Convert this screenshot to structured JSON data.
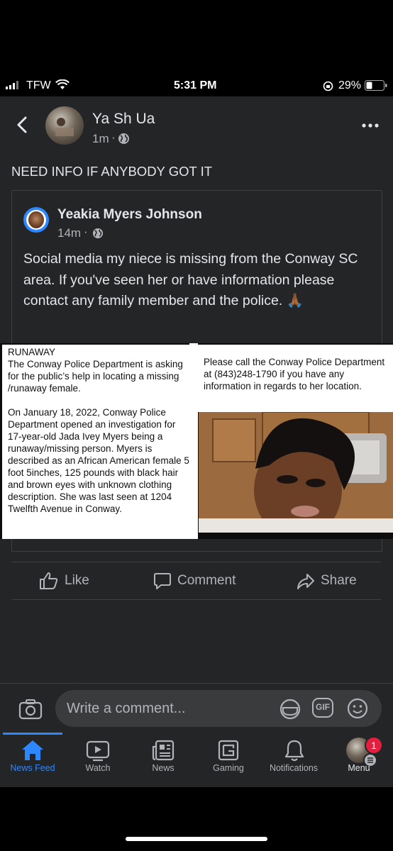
{
  "status_bar": {
    "carrier": "TFW",
    "time": "5:31 PM",
    "battery": "29%"
  },
  "header": {
    "author": "Ya Sh Ua",
    "time": "1m",
    "privacy_icon": "globe-icon"
  },
  "post_text": "NEED INFO IF ANYBODY GOT IT",
  "shared_post": {
    "author": "Yeakia Myers Johnson",
    "time": "14m",
    "text": "Social media my niece is missing from the Conway SC area. If you've seen her or have information please contact any family member and the police. 🙏🏾",
    "emoji": "🙏🏾",
    "image_left": {
      "heading": "RUNAWAY",
      "para1": "The Conway Police Department is asking for the public’s help in locating a missing /runaway female.",
      "para2": "On January 18, 2022, Conway Police Department opened an investigation for 17-year-old Jada Ivey Myers being a runaway/missing person. Myers is described as an African American female 5 foot 5inches, 125 pounds with black hair and brown eyes with unknown clothing description. She was last seen at 1204 Twelfth Avenue in Conway."
    },
    "image_right": {
      "text": "Please call the Conway Police Department at (843)248-1790 if you have any information in regards to her location."
    }
  },
  "actions": {
    "like": "Like",
    "comment": "Comment",
    "share": "Share"
  },
  "composer": {
    "placeholder": "Write a comment...",
    "gif": "GIF"
  },
  "bottom_nav": {
    "news_feed": "News Feed",
    "watch": "Watch",
    "news": "News",
    "gaming": "Gaming",
    "notifications": "Notifications",
    "menu": "Menu",
    "menu_badge": "1"
  },
  "colors": {
    "accent": "#2d88ff",
    "background": "#242526",
    "badge": "#e41e3f"
  }
}
